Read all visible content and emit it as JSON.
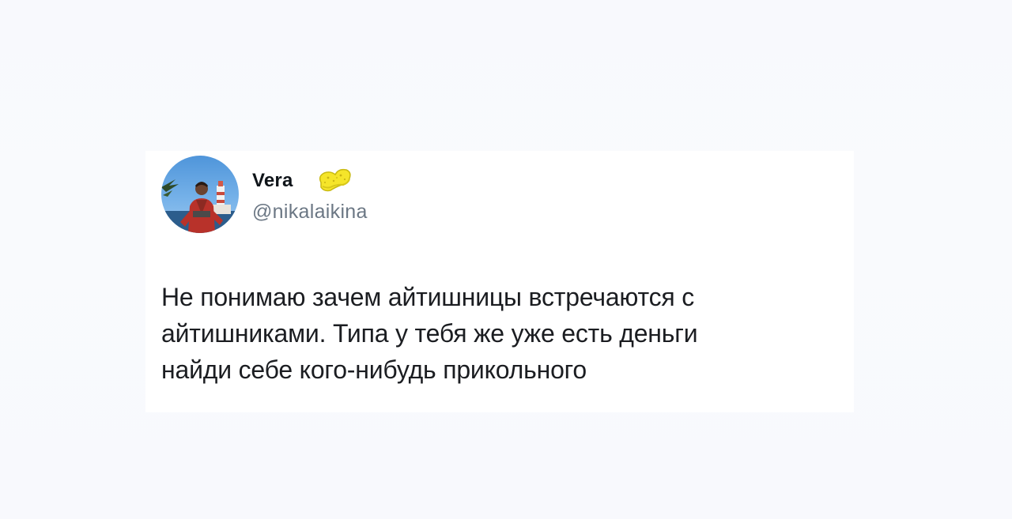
{
  "tweet": {
    "author": {
      "display_name": "Vera",
      "handle": "@nikalaikina",
      "badge_icon": "sponge-icon",
      "avatar": "user-avatar-photo"
    },
    "text_lines": [
      "Не понимаю зачем айтишницы встречаются с",
      "айтишниками. Типа у тебя же уже есть деньги",
      "найди себе кого-нибудь прикольного"
    ]
  },
  "colors": {
    "background": "#f8f9fd",
    "card": "#ffffff",
    "name": "#0f1419",
    "handle": "#6b7784",
    "text": "#1b1d21",
    "sponge": "#f5e52a"
  }
}
